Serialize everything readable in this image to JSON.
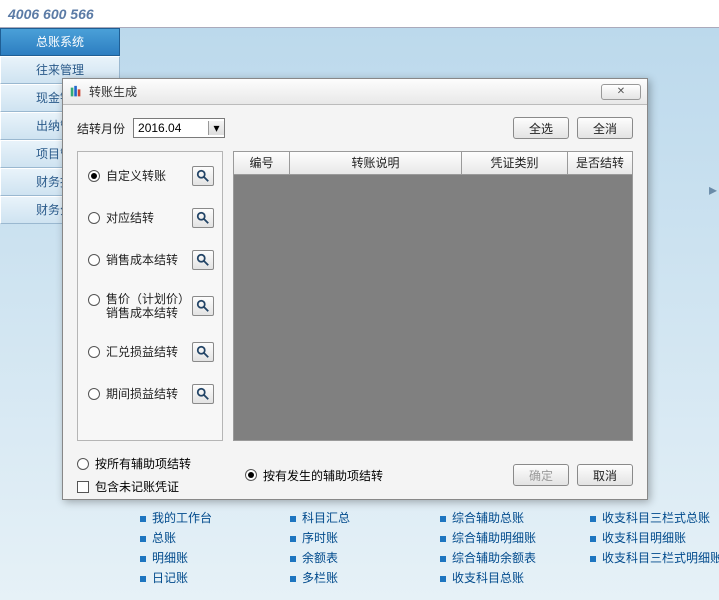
{
  "top_phone": "4006 600 566",
  "sidebar": {
    "items": [
      {
        "label": "总账系统",
        "active": true
      },
      {
        "label": "往来管理"
      },
      {
        "label": "现金银行"
      },
      {
        "label": "出纳管理"
      },
      {
        "label": "项目管理"
      },
      {
        "label": "财务报表"
      },
      {
        "label": "财务分析"
      }
    ]
  },
  "dialog": {
    "title": "转账生成",
    "month_label": "结转月份",
    "month_value": "2016.04",
    "btn_select_all": "全选",
    "btn_select_none": "全消",
    "radios": [
      "自定义转账",
      "对应结转",
      "销售成本结转",
      "售价（计划价）\n销售成本结转",
      "汇兑损益结转",
      "期间损益结转"
    ],
    "table_headers": {
      "c1": "编号",
      "c2": "转账说明",
      "c3": "凭证类别",
      "c4": "是否结转"
    },
    "bottom": {
      "opt1": "按所有辅助项结转",
      "opt2": "按有发生的辅助项结转",
      "chk": "包含未记账凭证",
      "ok": "确定",
      "cancel": "取消"
    }
  },
  "footer": {
    "col1": [
      "我的工作台",
      "总账",
      "明细账",
      "日记账"
    ],
    "col2": [
      "科目汇总",
      "序时账",
      "余额表",
      "多栏账"
    ],
    "col3": [
      "综合辅助总账",
      "综合辅助明细账",
      "综合辅助余额表",
      "收支科目总账"
    ],
    "col4": [
      "收支科目三栏式总账",
      "收支科目明细账",
      "收支科目三栏式明细账"
    ]
  }
}
